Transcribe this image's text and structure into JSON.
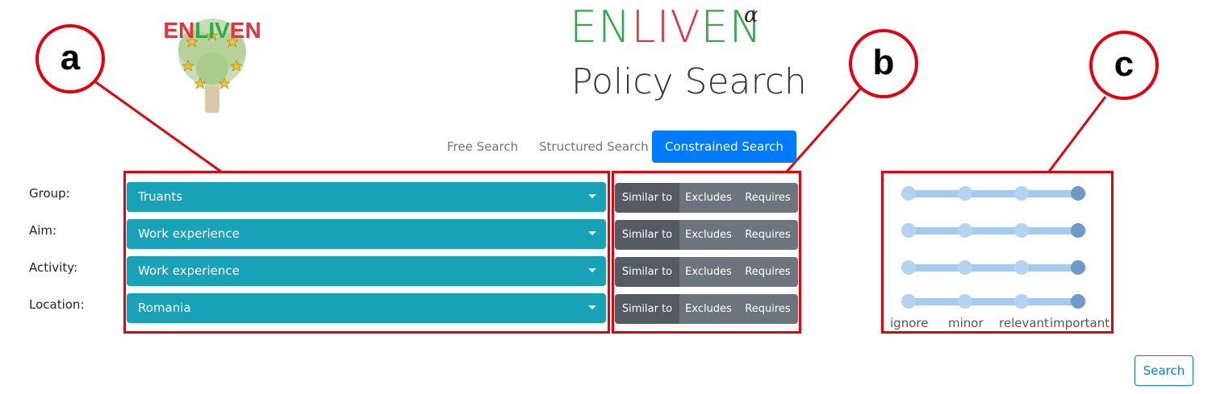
{
  "header": {
    "brand_letters": [
      {
        "ch": "EN",
        "color": "#2eaa47"
      },
      {
        "ch": "LIV",
        "color": "#e0343f"
      },
      {
        "ch": "EN",
        "color": "#2eaa47"
      }
    ],
    "alpha": "α",
    "subtitle": "Policy Search",
    "logo_text": "ENLIVEN"
  },
  "tabs": [
    {
      "label": "Free Search",
      "active": false
    },
    {
      "label": "Structured Search",
      "active": false
    },
    {
      "label": "Constrained Search",
      "active": true
    }
  ],
  "rows": [
    {
      "label": "Group:",
      "value": "Truants",
      "mode_active": "Similar to",
      "importance": "important"
    },
    {
      "label": "Aim:",
      "value": "Work experience",
      "mode_active": "Similar to",
      "importance": "important"
    },
    {
      "label": "Activity:",
      "value": "Work experience",
      "mode_active": "Similar to",
      "importance": "important"
    },
    {
      "label": "Location:",
      "value": "Romania",
      "mode_active": "Similar to",
      "importance": "important"
    }
  ],
  "modes": [
    "Similar to",
    "Excludes",
    "Requires"
  ],
  "importance_levels": [
    "ignore",
    "minor",
    "relevant",
    "important"
  ],
  "annotations": [
    "a",
    "b",
    "c"
  ],
  "search_button": "Search",
  "colors": {
    "primary": "#007bff",
    "dropdown": "#17a2b8",
    "button_secondary": "#6c757d",
    "annotation": "#e8000b"
  }
}
